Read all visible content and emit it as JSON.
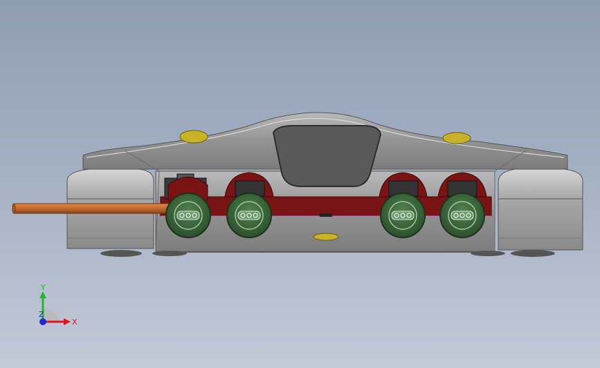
{
  "viewport": {
    "model": "game-console-front-view",
    "colors": {
      "background_top": "#8f9db3",
      "background_bottom": "#c3cad8",
      "body": "#8d8d8d",
      "body_light": "#b7b7b7",
      "port_green": "#3f6b3c",
      "inner_red": "#7a1414",
      "cable": "#c46a2e",
      "button_yellow": "#c8b228"
    }
  },
  "triad": {
    "x_label": "X",
    "y_label": "Y",
    "z_label": "Z",
    "colors": {
      "x": "#e0141c",
      "y": "#1fb82a",
      "z": "#1c2ad8"
    }
  }
}
